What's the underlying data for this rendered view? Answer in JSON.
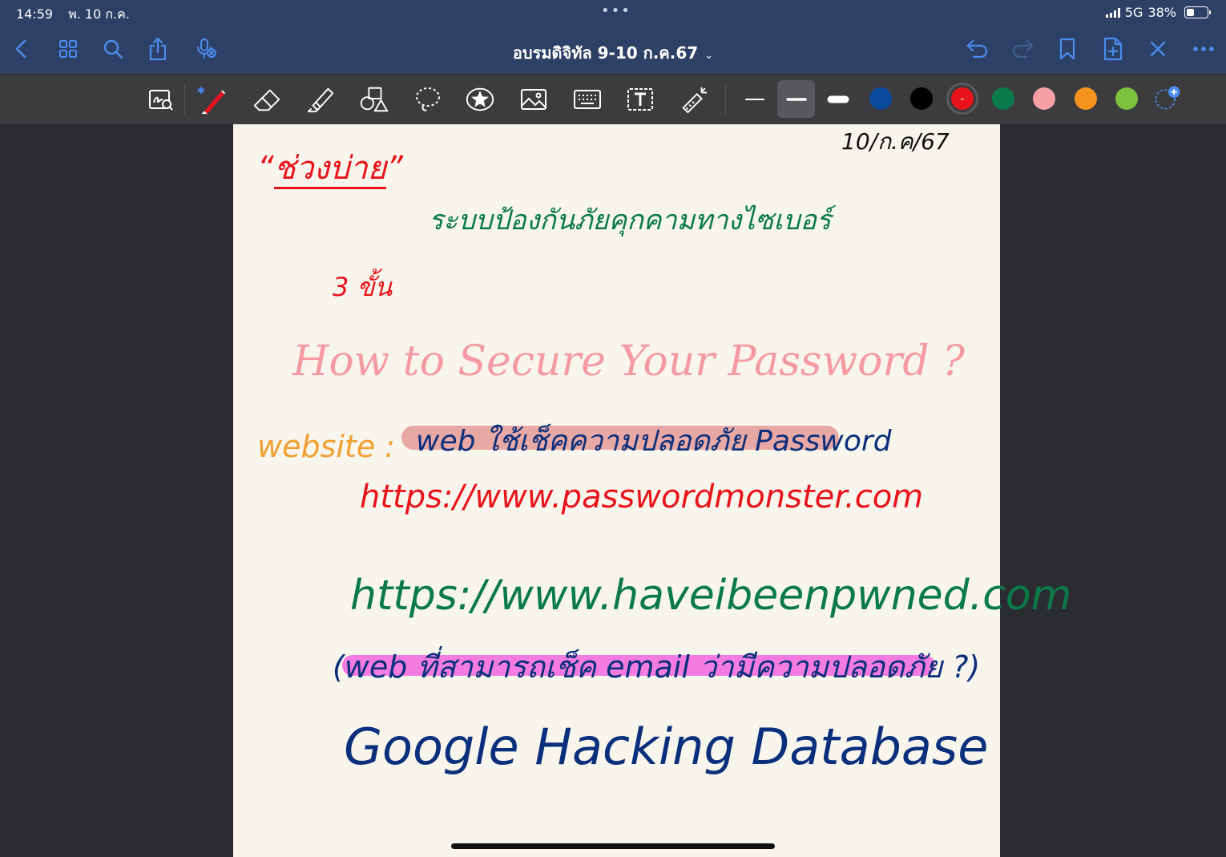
{
  "status": {
    "time": "14:59",
    "date": "พ. 10 ก.ค.",
    "network": "5G",
    "battery": "38%"
  },
  "nav": {
    "title": "อบรมดิจิทัล 9-10 ก.ค.67",
    "title_chevron": "⌄"
  },
  "toolbar": {
    "colors": [
      "#0a4a9c",
      "#000000",
      "#e8131b",
      "#0a7a4a",
      "#f6a0a6",
      "#f7941d",
      "#7cc23d"
    ],
    "selected_color": "#e8131b"
  },
  "note": {
    "date": "10/ก.ค/67",
    "header_red": "ช่วงบ่าย",
    "heading_green": "ระบบป้องกันภัยคุกคามทางไซเบอร์",
    "count_red": "3 ขั้น",
    "title_pink": "How to Secure Your Password ?",
    "website_label": "website :",
    "web_desc": "web ใช้เช็คความปลอดภัย Password",
    "url1": "https://www.passwordmonster.com",
    "url2": "https://www.haveibeenpwned.com",
    "web_desc2": "(web ที่สามารถเช็ค email ว่ามีความปลอดภัย ?)",
    "ghdb": "Google Hacking Database"
  }
}
